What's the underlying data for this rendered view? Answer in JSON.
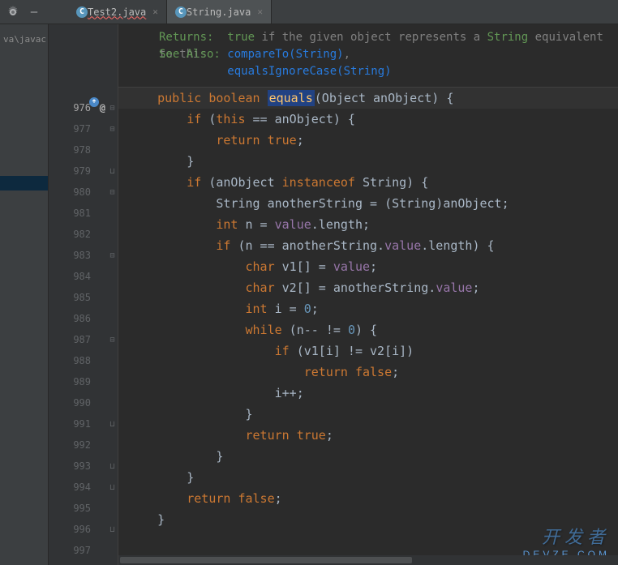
{
  "tabs": [
    {
      "label": "Test2.java",
      "hasError": true,
      "active": false
    },
    {
      "label": "String.java",
      "hasError": false,
      "active": true
    }
  ],
  "sidebar": {
    "path": "va\\javac"
  },
  "gutter": {
    "start": 976,
    "count": 22,
    "highlighted": 976
  },
  "doc": {
    "returns_label": "Returns:",
    "returns_text_pre": "true",
    "returns_text": " if the given object represents a ",
    "returns_text_type": "String",
    "returns_text_tail": " equivalent to this",
    "seealso_label": "See Also:",
    "link1": "compareTo(String)",
    "link2": "equalsIgnoreCase(String)"
  },
  "code": {
    "l976": {
      "public": "public",
      "boolean": "boolean",
      "name": "equals",
      "sig": "(Object anObject) {"
    },
    "l977": {
      "if": "if",
      "this": "this",
      "eq": " == anObject) {"
    },
    "l978": {
      "return": "return",
      "true": "true",
      "semi": ";"
    },
    "l979": "}",
    "l980": {
      "if": "if",
      "open": " (anObject ",
      "instanceof": "instanceof",
      "rest": " String) {"
    },
    "l981": "String anotherString = (String)anObject;",
    "l982": {
      "int": "int",
      "var": " n = ",
      "field": "value",
      "tail": ".length;"
    },
    "l983": {
      "if": "if",
      "open": " (n == anotherString.",
      "field": "value",
      "mid": ".length) {"
    },
    "l984": {
      "char": "char",
      "var": " v1[] = ",
      "field": "value",
      "semi": ";"
    },
    "l985": {
      "char": "char",
      "var": " v2[] = anotherString.",
      "field": "value",
      "semi": ";"
    },
    "l986": {
      "int": "int",
      "var": " i = ",
      "num": "0",
      "semi": ";"
    },
    "l987": {
      "while": "while",
      "cond": " (n-- != ",
      "num": "0",
      "tail": ") {"
    },
    "l988": {
      "if": "if",
      "cond": " (v1[i] != v2[i])"
    },
    "l989": {
      "return": "return",
      "false": "false",
      "semi": ";"
    },
    "l990": "i++;",
    "l991": "}",
    "l992": {
      "return": "return",
      "true": "true",
      "semi": ";"
    },
    "l993": "}",
    "l994": "}",
    "l995": {
      "return": "return",
      "false": "false",
      "semi": ";"
    },
    "l996": "}",
    "l997": ""
  },
  "watermark": {
    "main": "开发者",
    "sub": "DEVZE.COM"
  }
}
